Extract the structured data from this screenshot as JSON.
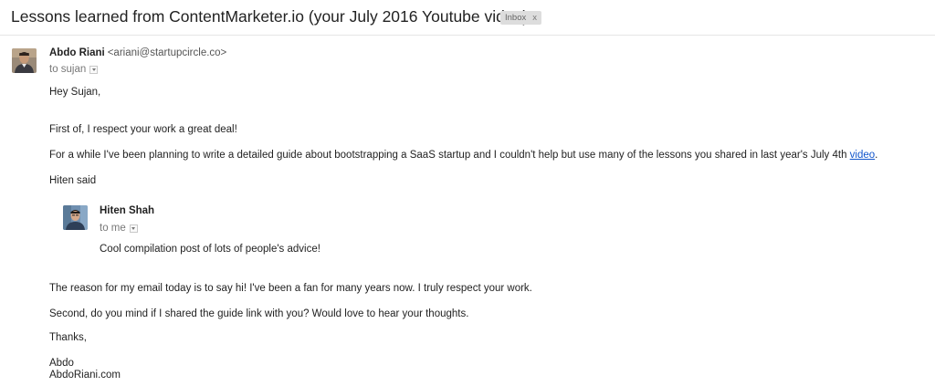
{
  "subject": {
    "title": "Lessons learned from ContentMarketer.io (your July 2016 Youtube video)",
    "label": "Inbox",
    "label_close": "x"
  },
  "message": {
    "sender_name": "Abdo Riani",
    "sender_email": "<ariani@startupcircle.co>",
    "to": "to sujan",
    "greeting": "Hey Sujan,",
    "p1": "First of, I respect your work a great deal!",
    "p2_text": "For a while I've been planning to write a detailed guide about bootstrapping a SaaS startup and I couldn't help but use many of the lessons you shared in last year's July 4th ",
    "p2_link": "video",
    "p2_end": ".",
    "p3": "Hiten said",
    "quote": {
      "sender_name": "Hiten Shah",
      "to": "to me",
      "text": "Cool compilation post of lots of people's advice!"
    },
    "p4": "The reason for my email today is to say hi! I've been a fan for many years now. I truly respect your work.",
    "p5": "Second, do you mind if I shared the guide link with you? Would love to hear your thoughts.",
    "closing": "Thanks,",
    "sig_name": "Abdo",
    "sig_site": "AbdoRiani.com"
  },
  "colors": {
    "link": "#1155cc",
    "label_bg": "#dddddd",
    "muted": "#777777"
  },
  "icons": {
    "sender_avatar": "avatar-photo",
    "quote_avatar": "avatar-photo",
    "details_dropdown": "chevron-down-icon"
  }
}
